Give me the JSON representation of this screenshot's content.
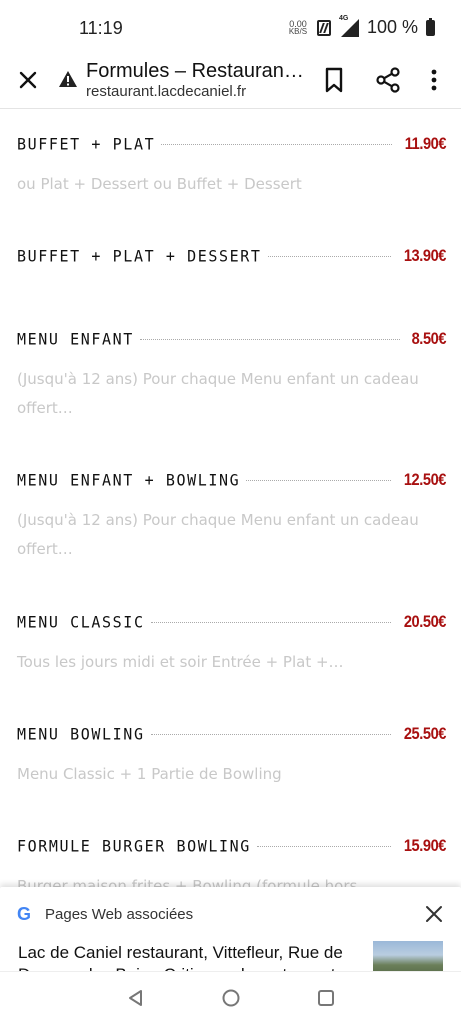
{
  "status_bar": {
    "time": "11:19",
    "net_speed_value": "0.00",
    "net_speed_unit": "KB/S",
    "network_label": "4G",
    "battery": "100 %"
  },
  "toolbar": {
    "title": "Formules – Restaurant…",
    "url": "restaurant.lacdecaniel.fr"
  },
  "menu": {
    "items": [
      {
        "name": "BUFFET + PLAT",
        "price": "11.90€",
        "desc": "ou Plat + Dessert ou Buffet + Dessert"
      },
      {
        "name": "BUFFET + PLAT + DESSERT",
        "price": "13.90€",
        "desc": ""
      },
      {
        "name": "MENU ENFANT",
        "price": "8.50€",
        "desc": "(Jusqu'à 12 ans) Pour chaque Menu enfant un cadeau offert…"
      },
      {
        "name": "MENU ENFANT + BOWLING",
        "price": "12.50€",
        "desc": "(Jusqu'à 12 ans) Pour chaque Menu enfant un cadeau offert…"
      },
      {
        "name": "MENU CLASSIC",
        "price": "20.50€",
        "desc": "Tous les jours midi et soir Entrée + Plat +…"
      },
      {
        "name": "MENU BOWLING",
        "price": "25.50€",
        "desc": "Menu Classic + 1 Partie de Bowling"
      },
      {
        "name": "FORMULE BURGER BOWLING",
        "price": "15.90€",
        "desc": "Burger maison frites + Bowling (formule hors bowling…"
      }
    ]
  },
  "bottom_sheet": {
    "title": "Pages Web associées",
    "result_text": "Lac de Caniel restaurant, Vittefleur, Rue de Dessous les Bois - Critiques de restaurant"
  },
  "colors": {
    "price": "#a81010",
    "desc": "#c8c8c8"
  }
}
